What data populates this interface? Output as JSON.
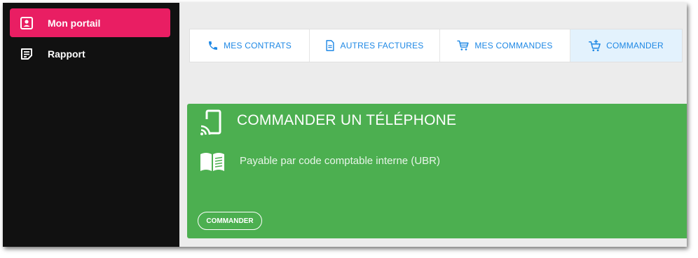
{
  "sidebar": {
    "items": [
      {
        "label": "Mon portail",
        "icon": "contact-card-icon",
        "active": true
      },
      {
        "label": "Rapport",
        "icon": "report-icon",
        "active": false
      }
    ]
  },
  "tabs": [
    {
      "label": "MES CONTRATS",
      "icon": "phone-icon",
      "active": false
    },
    {
      "label": "AUTRES FACTURES",
      "icon": "document-icon",
      "active": false
    },
    {
      "label": "MES COMMANDES",
      "icon": "cart-icon",
      "active": false
    },
    {
      "label": "COMMANDER",
      "icon": "cart-add-icon",
      "active": true
    }
  ],
  "card": {
    "title": "COMMANDER UN TÉLÉPHONE",
    "text": "Payable par code comptable interne (UBR)",
    "button_label": "COMMANDER",
    "icon": "cast-phone-icon",
    "text_icon": "open-book-icon"
  },
  "colors": {
    "sidebar_bg": "#111111",
    "active_item": "#e91e63",
    "tab_text": "#1e88e5",
    "active_tab_bg": "#e3f2fd",
    "card_bg": "#4caf50",
    "main_bg": "#ececec"
  }
}
